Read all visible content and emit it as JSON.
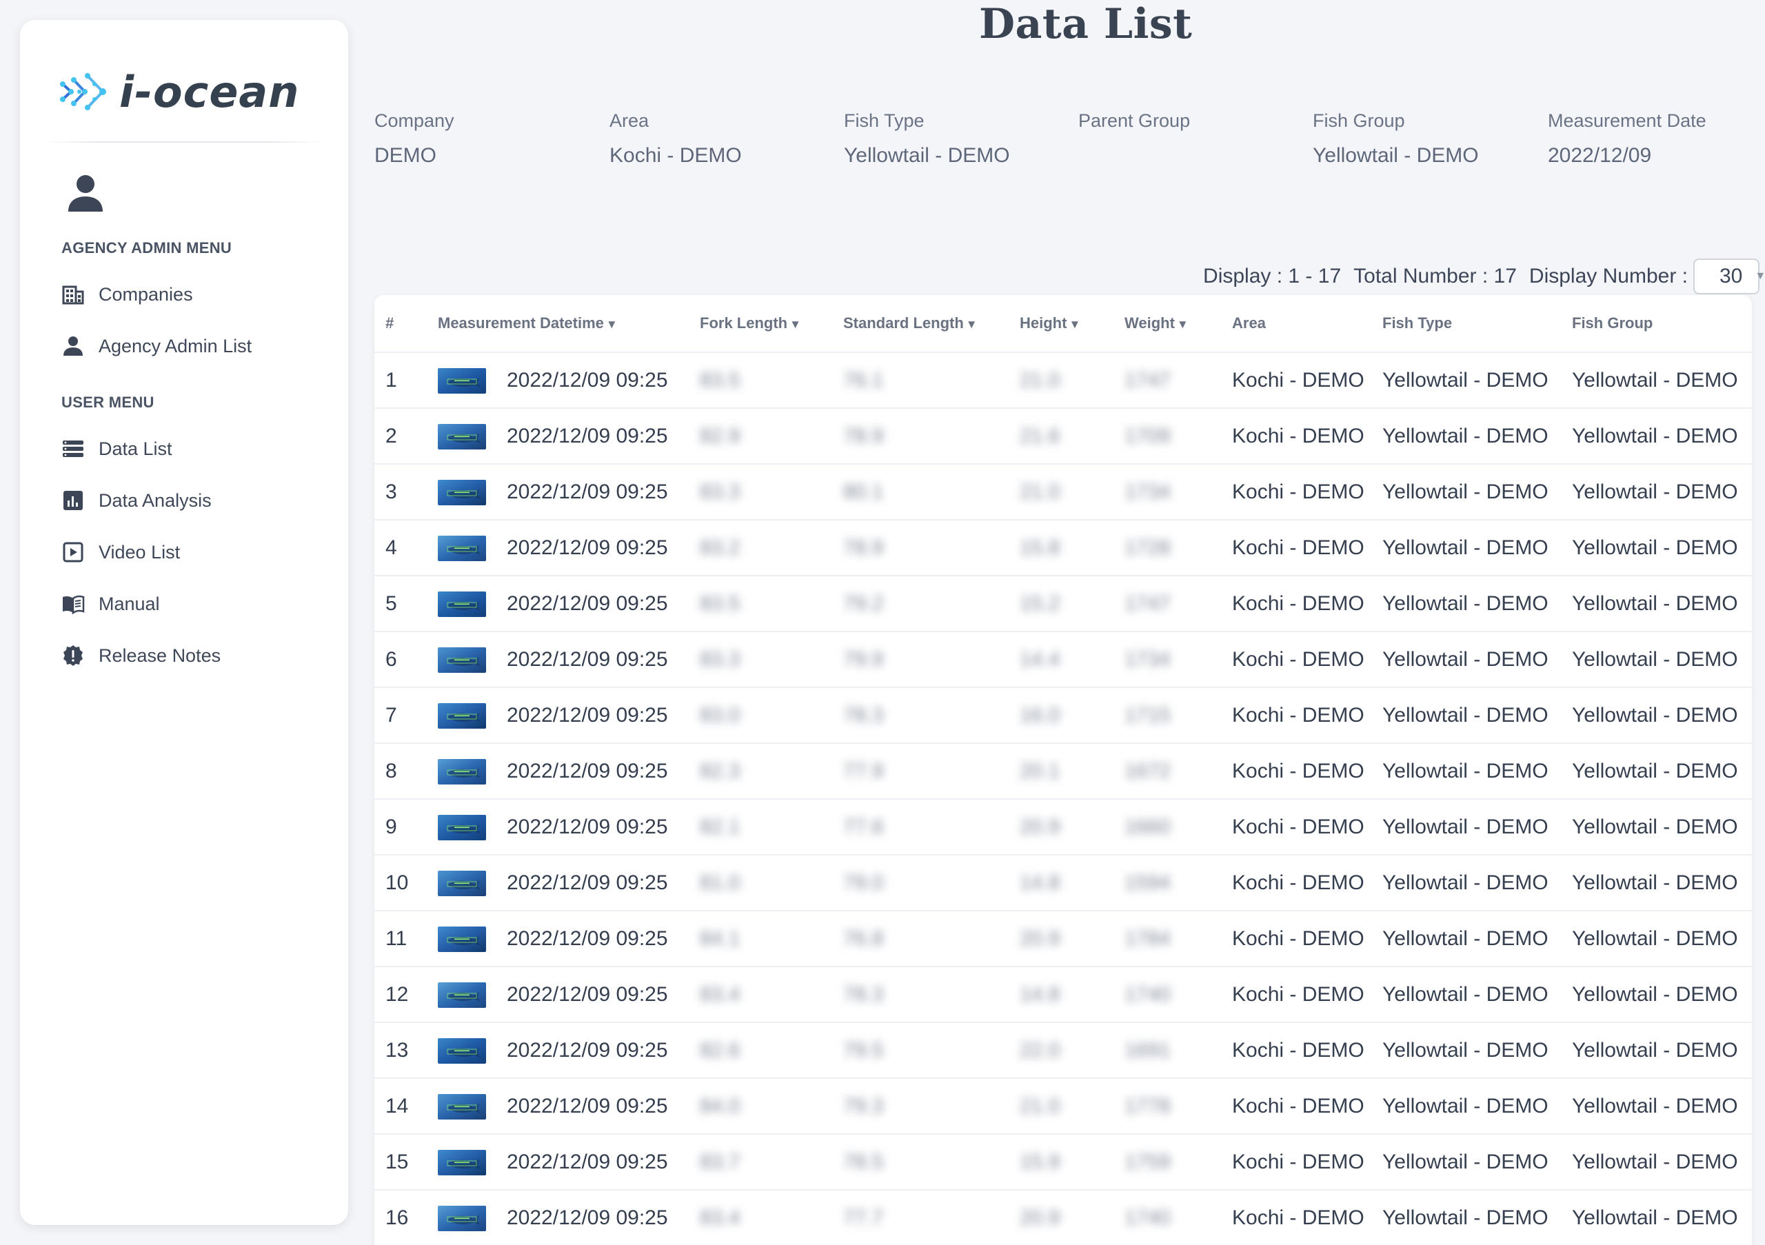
{
  "logo": {
    "text": "i-ocean"
  },
  "sidebar": {
    "agency_heading": "AGENCY ADMIN MENU",
    "agency_items": [
      {
        "label": "Companies",
        "icon": "building-icon"
      },
      {
        "label": "Agency Admin List",
        "icon": "person-icon"
      }
    ],
    "user_heading": "USER MENU",
    "user_items": [
      {
        "label": "Data List",
        "icon": "list-icon"
      },
      {
        "label": "Data Analysis",
        "icon": "chart-icon"
      },
      {
        "label": "Video List",
        "icon": "video-icon"
      },
      {
        "label": "Manual",
        "icon": "book-icon"
      },
      {
        "label": "Release Notes",
        "icon": "notes-badge-icon"
      }
    ]
  },
  "page": {
    "title": "Data List"
  },
  "filters": [
    {
      "key": "Company",
      "value": "DEMO"
    },
    {
      "key": "Area",
      "value": "Kochi - DEMO"
    },
    {
      "key": "Fish Type",
      "value": "Yellowtail - DEMO"
    },
    {
      "key": "Parent Group",
      "value": ""
    },
    {
      "key": "Fish Group",
      "value": "Yellowtail - DEMO"
    },
    {
      "key": "Measurement Date",
      "value": "2022/12/09"
    }
  ],
  "display": {
    "range": "Display : 1 - 17",
    "total": "Total Number : 17",
    "number_label": "Display Number :",
    "number_value": "30"
  },
  "table": {
    "columns": [
      "#",
      "Measurement Datetime",
      "Fork Length",
      "Standard Length",
      "Height",
      "Weight",
      "Area",
      "Fish Type",
      "Fish Group"
    ],
    "sort_glyph": "▼",
    "rows": [
      {
        "n": "1",
        "datetime": "2022/12/09 09:25",
        "fork": "83.5",
        "std": "76.1",
        "height": "21.0",
        "weight": "1747",
        "area": "Kochi - DEMO",
        "type": "Yellowtail - DEMO",
        "group": "Yellowtail - DEMO"
      },
      {
        "n": "2",
        "datetime": "2022/12/09 09:25",
        "fork": "82.9",
        "std": "78.9",
        "height": "21.6",
        "weight": "1709",
        "area": "Kochi - DEMO",
        "type": "Yellowtail - DEMO",
        "group": "Yellowtail - DEMO"
      },
      {
        "n": "3",
        "datetime": "2022/12/09 09:25",
        "fork": "83.3",
        "std": "80.1",
        "height": "21.0",
        "weight": "1734",
        "area": "Kochi - DEMO",
        "type": "Yellowtail - DEMO",
        "group": "Yellowtail - DEMO"
      },
      {
        "n": "4",
        "datetime": "2022/12/09 09:25",
        "fork": "83.2",
        "std": "78.9",
        "height": "15.8",
        "weight": "1728",
        "area": "Kochi - DEMO",
        "type": "Yellowtail - DEMO",
        "group": "Yellowtail - DEMO"
      },
      {
        "n": "5",
        "datetime": "2022/12/09 09:25",
        "fork": "83.5",
        "std": "79.2",
        "height": "15.2",
        "weight": "1747",
        "area": "Kochi - DEMO",
        "type": "Yellowtail - DEMO",
        "group": "Yellowtail - DEMO"
      },
      {
        "n": "6",
        "datetime": "2022/12/09 09:25",
        "fork": "83.3",
        "std": "79.9",
        "height": "14.4",
        "weight": "1734",
        "area": "Kochi - DEMO",
        "type": "Yellowtail - DEMO",
        "group": "Yellowtail - DEMO"
      },
      {
        "n": "7",
        "datetime": "2022/12/09 09:25",
        "fork": "83.0",
        "std": "78.3",
        "height": "16.0",
        "weight": "1715",
        "area": "Kochi - DEMO",
        "type": "Yellowtail - DEMO",
        "group": "Yellowtail - DEMO"
      },
      {
        "n": "8",
        "datetime": "2022/12/09 09:25",
        "fork": "82.3",
        "std": "77.9",
        "height": "20.1",
        "weight": "1672",
        "area": "Kochi - DEMO",
        "type": "Yellowtail - DEMO",
        "group": "Yellowtail - DEMO"
      },
      {
        "n": "9",
        "datetime": "2022/12/09 09:25",
        "fork": "82.1",
        "std": "77.6",
        "height": "20.9",
        "weight": "1660",
        "area": "Kochi - DEMO",
        "type": "Yellowtail - DEMO",
        "group": "Yellowtail - DEMO"
      },
      {
        "n": "10",
        "datetime": "2022/12/09 09:25",
        "fork": "81.0",
        "std": "79.0",
        "height": "14.8",
        "weight": "1594",
        "area": "Kochi - DEMO",
        "type": "Yellowtail - DEMO",
        "group": "Yellowtail - DEMO"
      },
      {
        "n": "11",
        "datetime": "2022/12/09 09:25",
        "fork": "84.1",
        "std": "76.8",
        "height": "20.9",
        "weight": "1784",
        "area": "Kochi - DEMO",
        "type": "Yellowtail - DEMO",
        "group": "Yellowtail - DEMO"
      },
      {
        "n": "12",
        "datetime": "2022/12/09 09:25",
        "fork": "83.4",
        "std": "78.3",
        "height": "14.8",
        "weight": "1740",
        "area": "Kochi - DEMO",
        "type": "Yellowtail - DEMO",
        "group": "Yellowtail - DEMO"
      },
      {
        "n": "13",
        "datetime": "2022/12/09 09:25",
        "fork": "82.6",
        "std": "79.5",
        "height": "22.0",
        "weight": "1691",
        "area": "Kochi - DEMO",
        "type": "Yellowtail - DEMO",
        "group": "Yellowtail - DEMO"
      },
      {
        "n": "14",
        "datetime": "2022/12/09 09:25",
        "fork": "84.0",
        "std": "79.3",
        "height": "21.0",
        "weight": "1778",
        "area": "Kochi - DEMO",
        "type": "Yellowtail - DEMO",
        "group": "Yellowtail - DEMO"
      },
      {
        "n": "15",
        "datetime": "2022/12/09 09:25",
        "fork": "83.7",
        "std": "78.5",
        "height": "15.9",
        "weight": "1759",
        "area": "Kochi - DEMO",
        "type": "Yellowtail - DEMO",
        "group": "Yellowtail - DEMO"
      },
      {
        "n": "16",
        "datetime": "2022/12/09 09:25",
        "fork": "83.4",
        "std": "77.7",
        "height": "20.9",
        "weight": "1740",
        "area": "Kochi - DEMO",
        "type": "Yellowtail - DEMO",
        "group": "Yellowtail - DEMO"
      }
    ]
  }
}
